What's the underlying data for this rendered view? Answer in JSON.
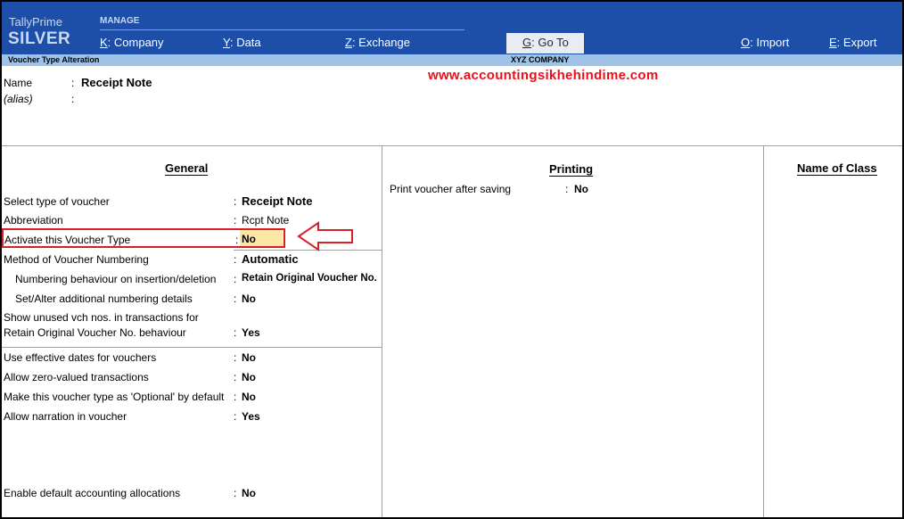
{
  "app": {
    "brand_small": "TallyPrime",
    "brand_edition": "SILVER",
    "section_label": "MANAGE"
  },
  "menu": {
    "company": {
      "key": "K",
      "label": ": Company"
    },
    "data": {
      "key": "Y",
      "label": ": Data"
    },
    "exchange": {
      "key": "Z",
      "label": ": Exchange"
    },
    "goto": {
      "key": "G",
      "label": ": Go To"
    },
    "import": {
      "key": "O",
      "label": ": Import"
    },
    "export": {
      "key": "E",
      "label": ": Export"
    }
  },
  "subbar": {
    "screen_title": "Voucher Type Alteration",
    "company": "XYZ COMPANY"
  },
  "watermark": "www.accountingsikhehindime.com",
  "header": {
    "name_label": "Name",
    "name_colon": ":",
    "name_value": "Receipt Note",
    "alias_label": "(alias)",
    "alias_colon": ":"
  },
  "general": {
    "heading": "General",
    "rows": [
      {
        "label": "Select type of voucher",
        "colon": ":",
        "value": "Receipt Note"
      },
      {
        "label": "Abbreviation",
        "colon": ":",
        "value": "Rcpt Note"
      },
      {
        "label": "Activate this Voucher Type",
        "colon": ":",
        "value": "No"
      },
      {
        "label": "Method of Voucher Numbering",
        "colon": ":",
        "value": "Automatic"
      },
      {
        "label": "Numbering behaviour on insertion/deletion",
        "colon": ":",
        "value": "Retain Original Voucher No."
      },
      {
        "label": "Set/Alter additional numbering details",
        "colon": ":",
        "value": "No"
      },
      {
        "label": "Show unused vch nos. in transactions for",
        "colon": "",
        "value": ""
      },
      {
        "label": "Retain Original Voucher No. behaviour",
        "colon": ":",
        "value": "Yes"
      },
      {
        "label": "Use effective dates for vouchers",
        "colon": ":",
        "value": "No"
      },
      {
        "label": "Allow zero-valued transactions",
        "colon": ":",
        "value": "No"
      },
      {
        "label": "Make this voucher type as 'Optional' by default",
        "colon": ":",
        "value": "No"
      },
      {
        "label": "Allow narration in voucher",
        "colon": ":",
        "value": "Yes"
      },
      {
        "label": "Enable default accounting allocations",
        "colon": ":",
        "value": "No"
      }
    ]
  },
  "printing": {
    "heading": "Printing",
    "rows": [
      {
        "label": "Print voucher after saving",
        "colon": ":",
        "value": "No"
      }
    ]
  },
  "class": {
    "heading": "Name of Class"
  },
  "colors": {
    "topbar": "#1d4ea8",
    "subbar": "#9fc3e6",
    "highlight_border": "#d81f26",
    "highlight_fill": "#fde7a6",
    "watermark": "#e8101c"
  }
}
